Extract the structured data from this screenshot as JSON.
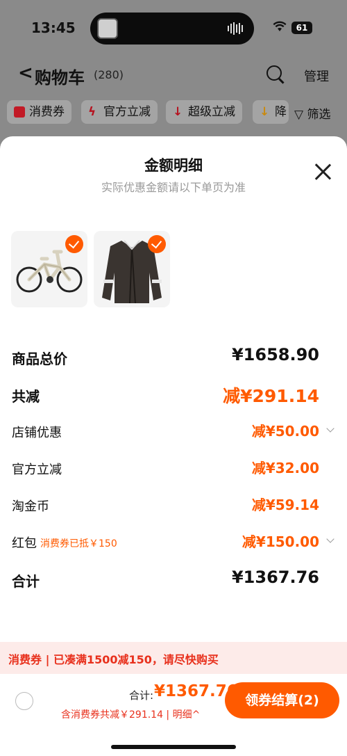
{
  "status": {
    "time": "13:45",
    "battery": "61"
  },
  "nav": {
    "back": "<",
    "title": "购物车",
    "count": "(280)",
    "manage": "管理"
  },
  "filters": [
    {
      "label": "消费券",
      "color": "#e11d2b"
    },
    {
      "label": "官方立减",
      "color": "#e11d2b"
    },
    {
      "label": "超级立减",
      "color": "#e11d2b"
    },
    {
      "label": "降",
      "color": "#f0a21a"
    }
  ],
  "filter_btn": "▽ 筛选",
  "sheet": {
    "title": "金额明细",
    "subtitle": "实际优惠金额请以下单页为准"
  },
  "rows": {
    "total_price": {
      "label": "商品总价",
      "value": "¥1658.90"
    },
    "total_off": {
      "label": "共减",
      "value": "减¥291.14"
    },
    "store": {
      "label": "店铺优惠",
      "value": "减¥50.00"
    },
    "official": {
      "label": "官方立减",
      "value": "减¥32.00"
    },
    "coins": {
      "label": "淘金币",
      "value": "减¥59.14"
    },
    "redpack": {
      "label": "红包",
      "note": "消费券已抵￥150",
      "value": "减¥150.00"
    },
    "sum": {
      "label": "合计",
      "value": "¥1367.76"
    }
  },
  "promo": "消费券 | 已凑满1500减150，请尽快购买",
  "footer": {
    "total_label": "合计:",
    "total_value": "¥1367.76",
    "saved": "含消费券共减￥291.14 | 明细^",
    "checkout": "领券结算(2)"
  },
  "colors": {
    "accent": "#ff5a00",
    "promo_red": "#e8301c"
  }
}
